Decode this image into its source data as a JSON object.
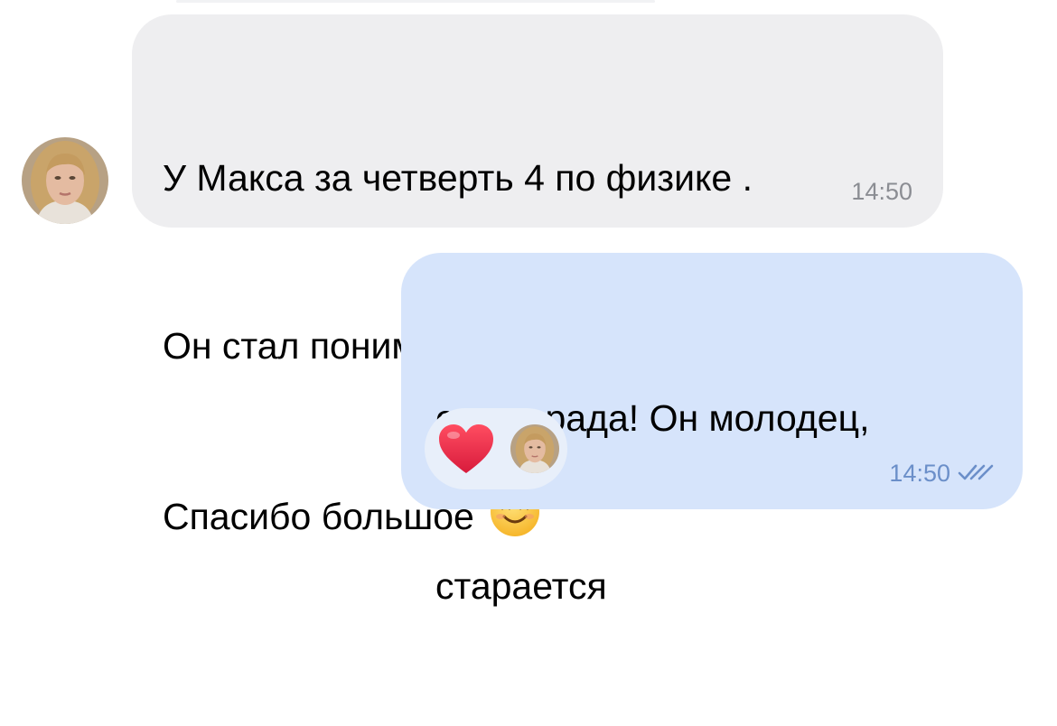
{
  "incoming_message": {
    "lines": [
      "У Макса за четверть 4 по физике .",
      "Он стал понимать этот предмет.",
      "Спасибо большое"
    ],
    "emoji": "smiling-face-emoji",
    "time": "14:50"
  },
  "outgoing_message": {
    "lines": [
      "очень рада! Он молодец,",
      "старается"
    ],
    "time": "14:50",
    "status_icon": "double-check-icon",
    "reactions": [
      {
        "icon": "red-heart-emoji"
      },
      {
        "icon": "reactor-avatar"
      }
    ]
  },
  "colors": {
    "incoming_bubble": "#eeeef0",
    "outgoing_bubble": "#d6e4fb",
    "reaction_pill": "#e8effa",
    "time_gray": "#8b8d93",
    "time_blue": "#6b8fc9"
  }
}
